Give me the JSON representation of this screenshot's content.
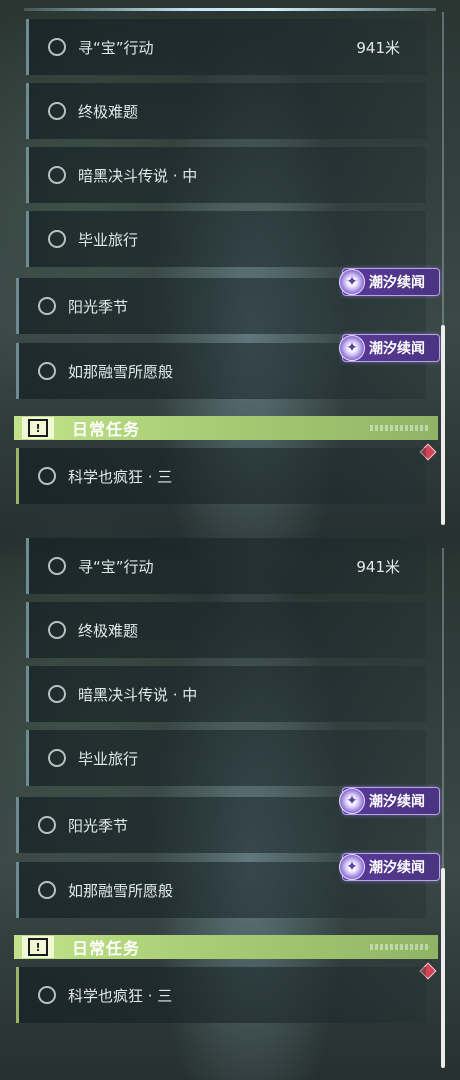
{
  "quests": [
    {
      "label": "寻“宝”行动",
      "distance": "941米"
    },
    {
      "label": "终极难题"
    },
    {
      "label": "暗黑决斗传说 · 中"
    },
    {
      "label": "毕业旅行"
    },
    {
      "label": "阳光季节",
      "tag": "潮汐续闻"
    },
    {
      "label": "如那融雪所愿般",
      "tag": "潮汐续闻"
    }
  ],
  "daily": {
    "header_title": "日常任务",
    "header_icon": "exclamation-icon",
    "items": [
      {
        "label": "科学也疯狂 · 三"
      }
    ]
  },
  "colors": {
    "daily_accent": "#a9cf77",
    "tag_purple": "#5a3a9a",
    "marker_red": "#d34556"
  },
  "icons": {
    "status": "circle-outline-icon",
    "tag": "tide-event-icon",
    "marker": "diamond-marker-icon"
  }
}
